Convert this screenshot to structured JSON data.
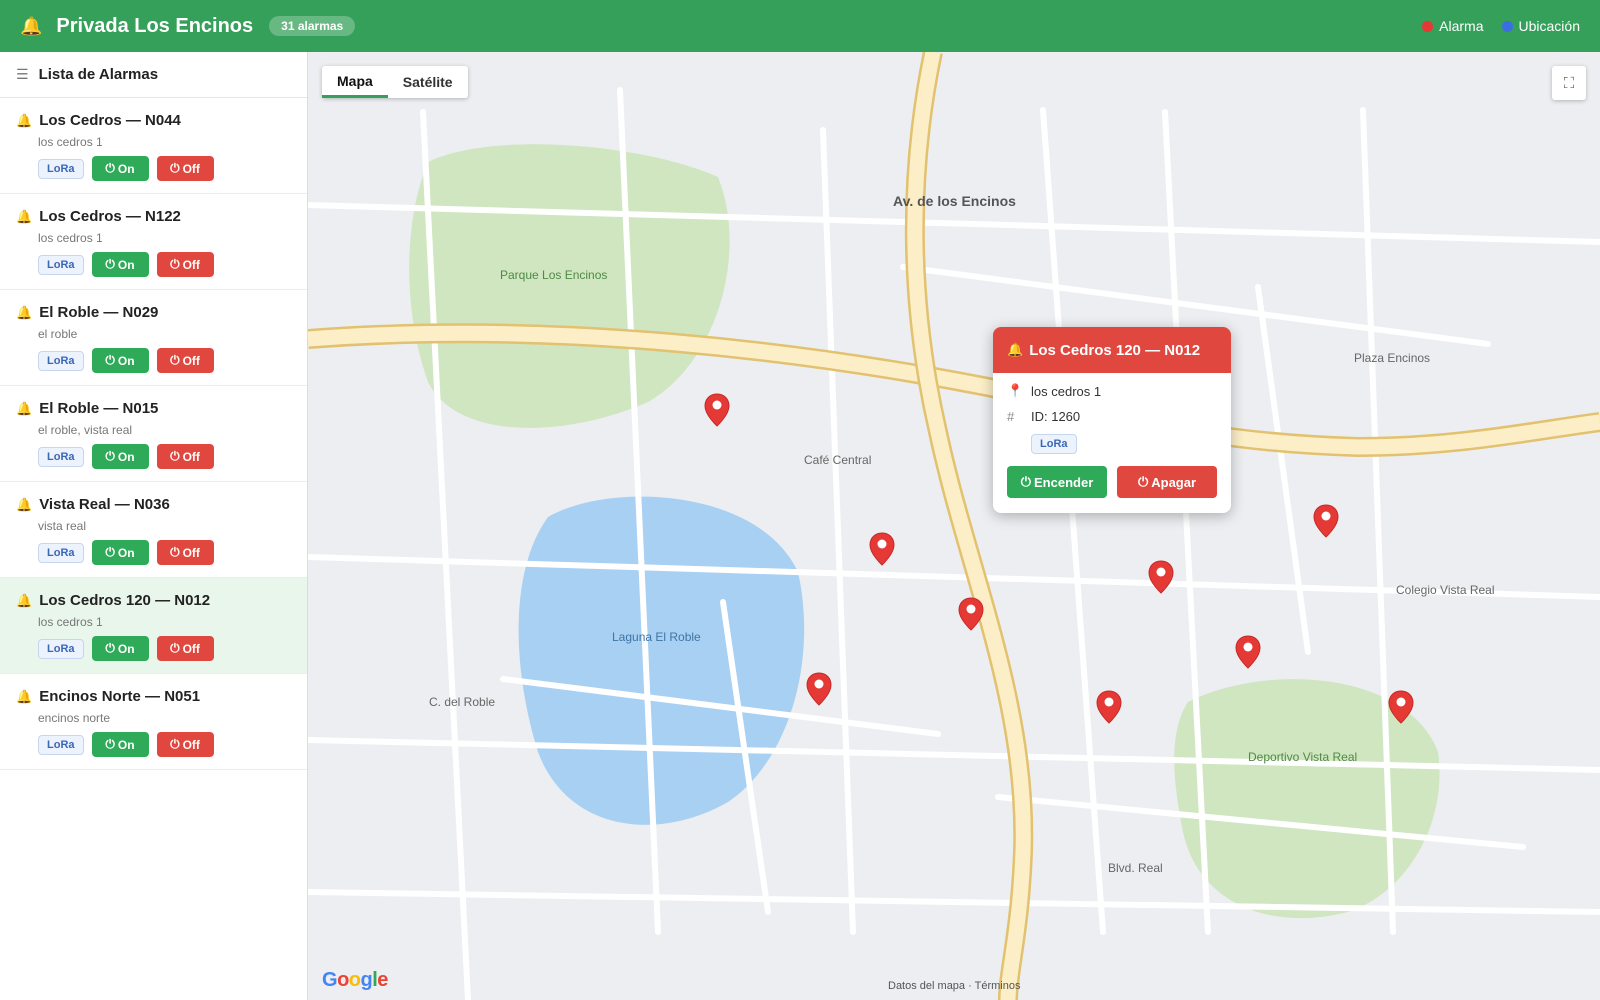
{
  "header": {
    "title": "Privada Los Encinos",
    "badge": "31 alarmas",
    "legend": [
      {
        "label": "Alarma",
        "color": "#e53935"
      },
      {
        "label": "Ubicación",
        "color": "#3b6fe0"
      }
    ],
    "icon": "bell-icon"
  },
  "sidebar": {
    "heading": "Lista de Alarmas",
    "items": [
      {
        "title": "Los Cedros — N044",
        "subtitle": "los cedros 1",
        "tag": "LoRa",
        "on_label": "On",
        "off_label": "Off",
        "selected": false
      },
      {
        "title": "Los Cedros — N122",
        "subtitle": "los cedros 1",
        "tag": "LoRa",
        "on_label": "On",
        "off_label": "Off",
        "selected": false
      },
      {
        "title": "El Roble — N029",
        "subtitle": "el roble",
        "tag": "LoRa",
        "on_label": "On",
        "off_label": "Off",
        "selected": false
      },
      {
        "title": "El Roble — N015",
        "subtitle": "el roble, vista real",
        "tag": "LoRa",
        "on_label": "On",
        "off_label": "Off",
        "selected": false
      },
      {
        "title": "Vista Real — N036",
        "subtitle": "vista real",
        "tag": "LoRa",
        "on_label": "On",
        "off_label": "Off",
        "selected": false
      },
      {
        "title": "Los Cedros 120 — N012",
        "subtitle": "los cedros 1",
        "tag": "LoRa",
        "on_label": "On",
        "off_label": "Off",
        "selected": true
      },
      {
        "title": "Encinos Norte — N051",
        "subtitle": "encinos norte",
        "tag": "LoRa",
        "on_label": "On",
        "off_label": "Off",
        "selected": false
      }
    ]
  },
  "map": {
    "tabs": [
      "Mapa",
      "Satélite"
    ],
    "active_tab": "Mapa",
    "labels": {
      "road_main": "Av. de los Encinos",
      "park1": "Parque Los Encinos",
      "plaza": "Plaza Encinos",
      "cafe": "Café Central",
      "lake": "Laguna El Roble",
      "school": "Colegio Vista Real",
      "street1": "C. del Roble",
      "sports": "Deportivo Vista Real",
      "blvd": "Blvd. Real"
    },
    "google": "Google",
    "attribution": "Datos del mapa · Términos",
    "pin_color": "#e53935"
  },
  "popup": {
    "title": "Los Cedros 120 — N012",
    "address": "los cedros 1",
    "id_text": "ID: 1260",
    "tag": "LoRa",
    "on_label": "Encender",
    "off_label": "Apagar"
  }
}
